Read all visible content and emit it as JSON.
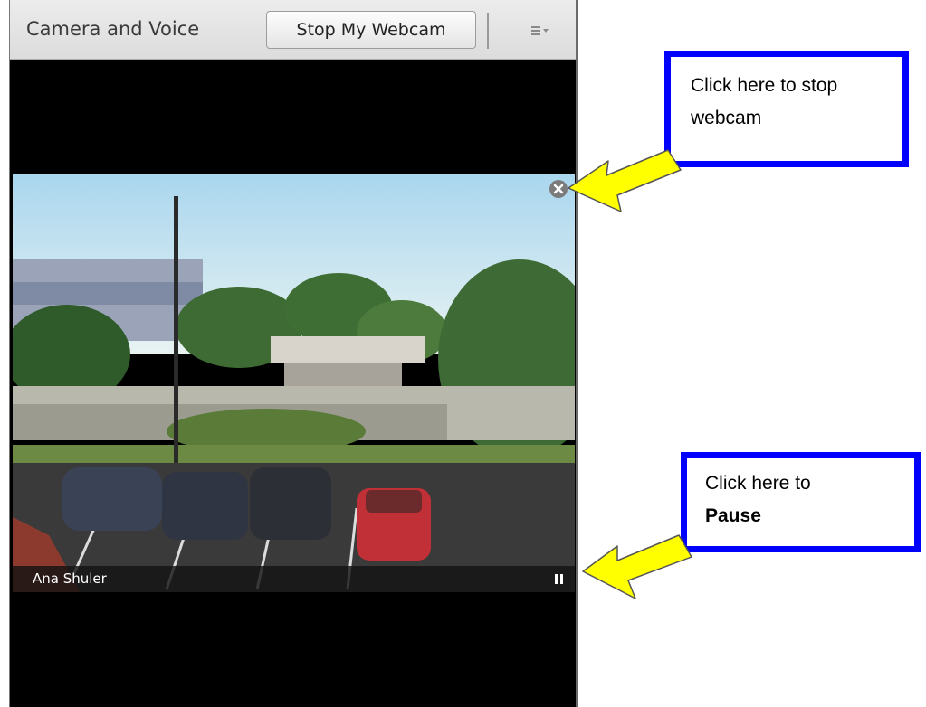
{
  "pod": {
    "title": "Camera and Voice",
    "stop_button_label": "Stop My Webcam",
    "menu_icon": "hamburger-menu-icon"
  },
  "video": {
    "participant_name": "Ana Shuler",
    "close_icon": "close-circle-icon",
    "pause_icon": "pause-icon"
  },
  "callouts": {
    "stop_webcam": {
      "line1": "Click here to stop",
      "line2": "webcam"
    },
    "pause": {
      "line1": "Click here to",
      "line2": "Pause"
    }
  },
  "colors": {
    "callout_border": "#0000ff",
    "arrow_fill": "#ffff00",
    "pod_background": "#000000"
  }
}
